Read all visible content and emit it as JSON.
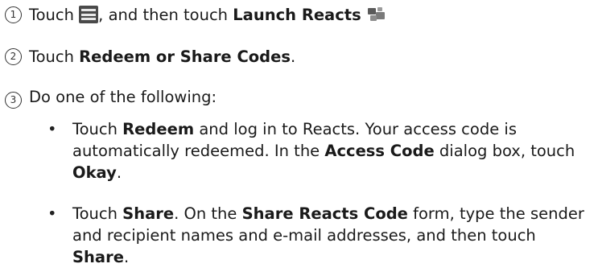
{
  "steps": [
    {
      "number": "1",
      "text1": "Touch ",
      "text2": ", and then touch ",
      "bold1": "Launch Reacts",
      "icons": [
        "menu-icon",
        "reacts-icon"
      ]
    },
    {
      "number": "2",
      "text1": "Touch ",
      "bold1": "Redeem or Share Codes",
      "text2": "."
    },
    {
      "number": "3",
      "text1": "Do one of the following:"
    }
  ],
  "bullets": [
    {
      "marker": "•",
      "t1": "Touch ",
      "b1": "Redeem",
      "t2": " and log in to Reacts. Your access code is automatically redeemed. In the ",
      "b2": "Access Code",
      "t3": " dialog box, touch ",
      "b3": "Okay",
      "t4": "."
    },
    {
      "marker": "•",
      "t1": "Touch ",
      "b1": "Share",
      "t2": ". On the ",
      "b2": "Share Reacts Code",
      "t3": " form, type the sender and recipient names and e-mail addresses, and then touch ",
      "b3": "Share",
      "t4": "."
    }
  ]
}
